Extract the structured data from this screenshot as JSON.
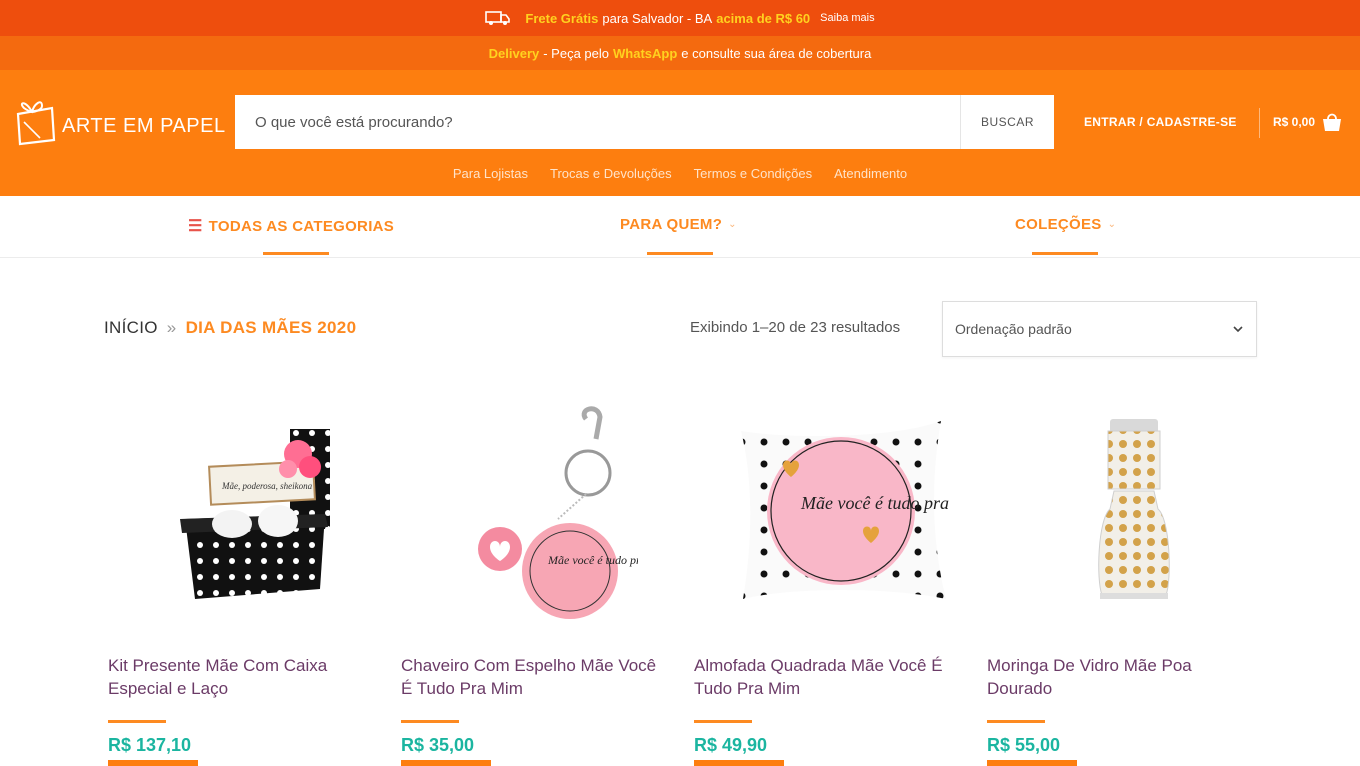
{
  "announcement": {
    "free_shipping": "Frete Grátis",
    "for_city": "para Salvador - BA",
    "above": "acima de R$ 60",
    "learn_more": "Saiba mais"
  },
  "delivery_bar": {
    "delivery": "Delivery",
    "order_via": "- Peça pelo",
    "whatsapp": "WhatsApp",
    "coverage": "e consulte sua área de cobertura"
  },
  "header": {
    "logo_text": "ARTE EM PAPEL",
    "search_placeholder": "O que você está procurando?",
    "search_button": "BUSCAR",
    "login_label": "ENTRAR / CADASTRE-SE",
    "cart_total": "R$ 0,00",
    "links": [
      "Para Lojistas",
      "Trocas e Devoluções",
      "Termos e Condições",
      "Atendimento"
    ]
  },
  "category_nav": {
    "all_categories": "TODAS AS CATEGORIAS",
    "for_whom": "PARA QUEM?",
    "collections": "COLEÇÕES"
  },
  "breadcrumb": {
    "home": "INÍCIO",
    "separator": "»",
    "current": "DIA DAS MÃES 2020"
  },
  "results_text": "Exibindo 1–20 de 23 resultados",
  "sort": {
    "selected": "Ordenação padrão"
  },
  "products": [
    {
      "name": "Kit Presente Mãe Com Caixa Especial e Laço",
      "price": "R$ 137,10",
      "image_text": "Mãe, poderosa, sheikona"
    },
    {
      "name": "Chaveiro Com Espelho Mãe Você É Tudo Pra Mim",
      "price": "R$ 35,00",
      "image_text": "Mãe você é tudo pra mim"
    },
    {
      "name": "Almofada Quadrada Mãe Você É Tudo Pra Mim",
      "price": "R$ 49,90",
      "image_text": "Mãe você é tudo pra mim"
    },
    {
      "name": "Moringa De Vidro Mãe Poa Dourado",
      "price": "R$ 55,00"
    }
  ],
  "colors": {
    "top_red": "#ee4e0d",
    "orange": "#fd7e0f",
    "accent": "#fd8a21",
    "highlight_yellow": "#ffd21f",
    "price_teal": "#1bb5a0",
    "title_purple": "#6b3b67"
  }
}
